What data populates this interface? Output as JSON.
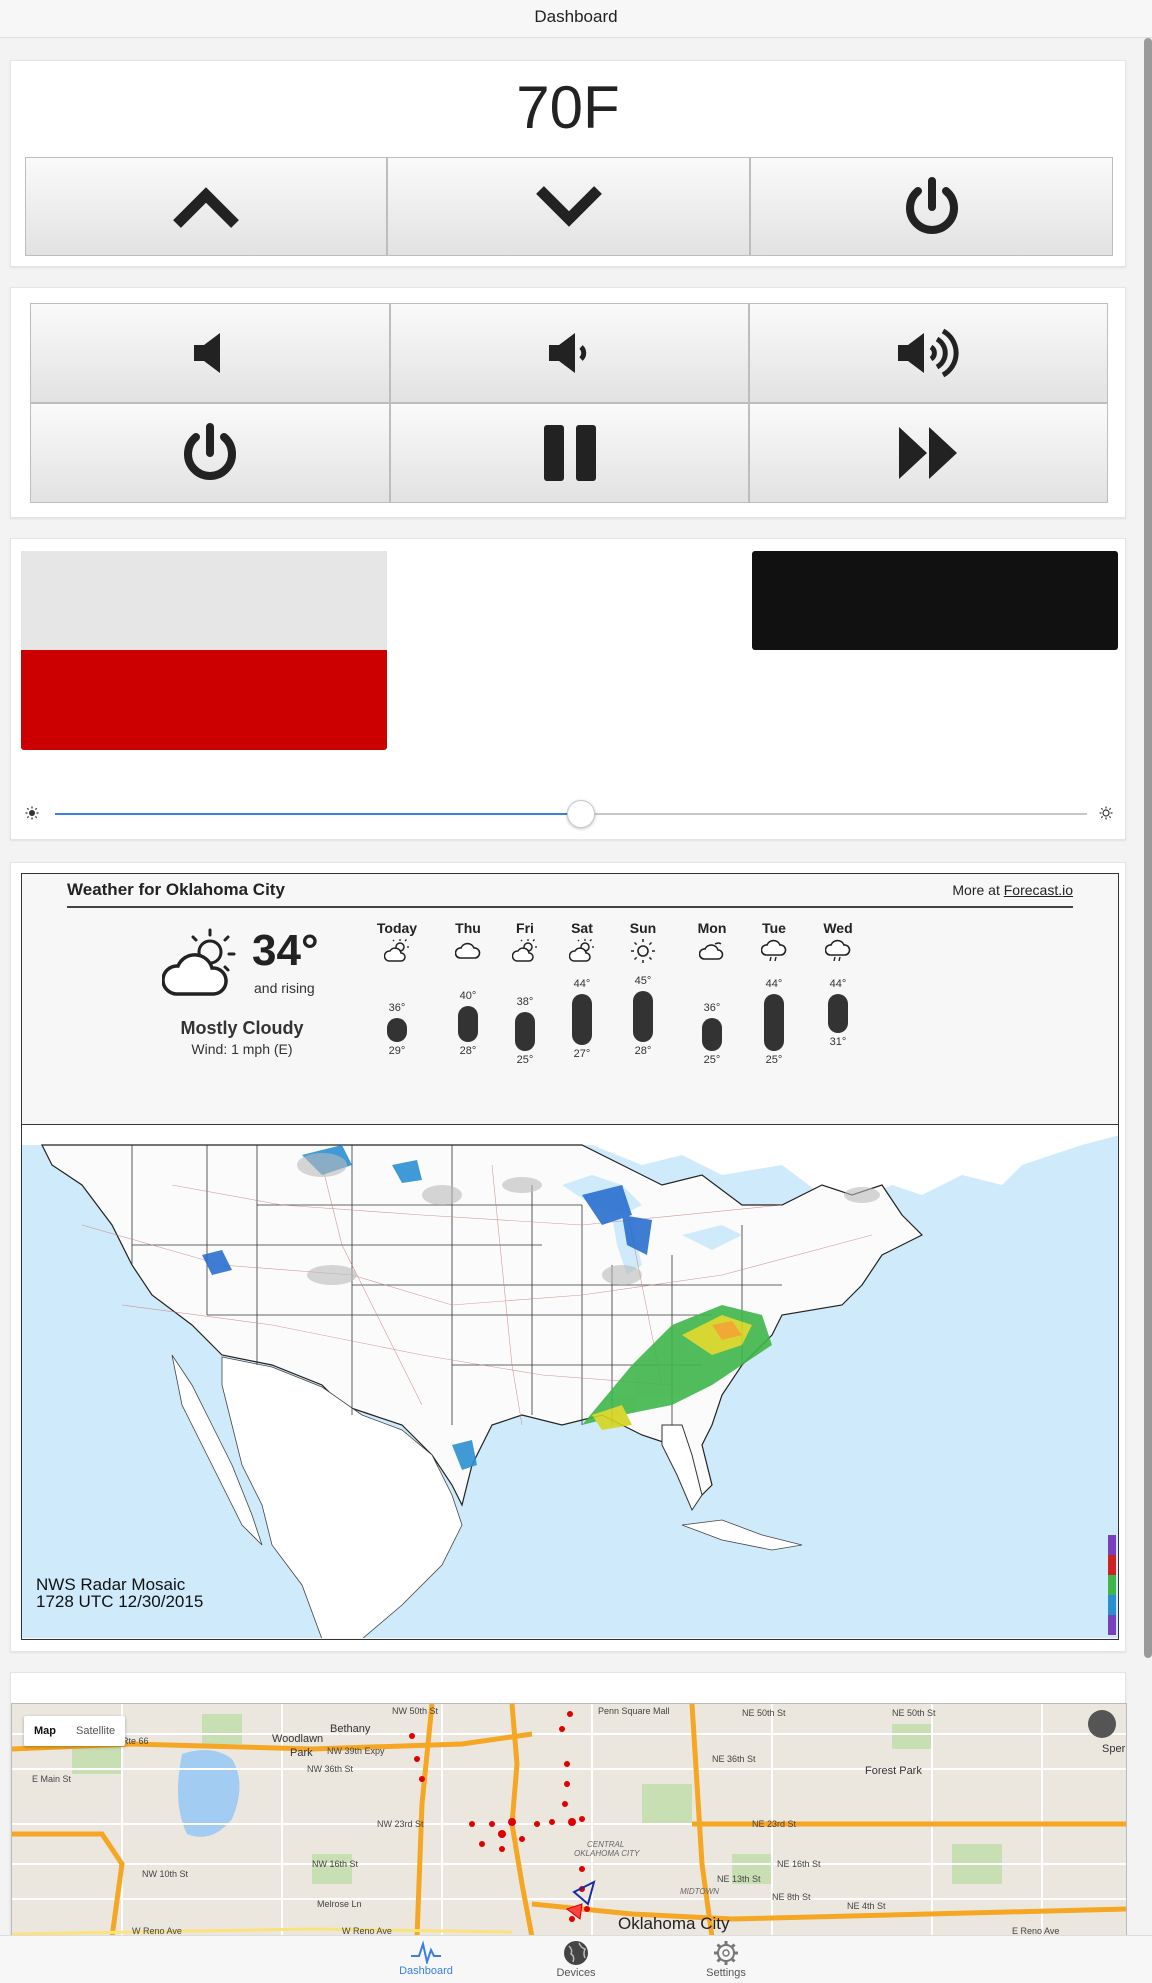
{
  "topbar": {
    "title": "Dashboard"
  },
  "thermostat": {
    "temperature": "70F"
  },
  "radar": {
    "label_line1": "NWS Radar Mosaic",
    "label_line2": "1728 UTC 12/30/2015"
  },
  "weather": {
    "title": "Weather for Oklahoma City",
    "more_prefix": "More at",
    "more_link": "Forecast.io",
    "current": {
      "temp": "34°",
      "trend": "and rising",
      "summary": "Mostly Cloudy",
      "wind": "Wind: 1 mph (E)"
    },
    "days": [
      {
        "name": "Today",
        "icon": "partly-cloudy-icon",
        "hi": "36°",
        "lo": "29°",
        "hi_n": 36,
        "lo_n": 29
      },
      {
        "name": "Thu",
        "icon": "cloudy-icon",
        "hi": "40°",
        "lo": "28°",
        "hi_n": 40,
        "lo_n": 28
      },
      {
        "name": "Fri",
        "icon": "partly-cloudy-icon",
        "hi": "38°",
        "lo": "25°",
        "hi_n": 38,
        "lo_n": 25
      },
      {
        "name": "Sat",
        "icon": "partly-cloudy-icon",
        "hi": "44°",
        "lo": "27°",
        "hi_n": 44,
        "lo_n": 27
      },
      {
        "name": "Sun",
        "icon": "sunny-icon",
        "hi": "45°",
        "lo": "28°",
        "hi_n": 45,
        "lo_n": 28
      },
      {
        "name": "Mon",
        "icon": "wind-cloud-icon",
        "hi": "36°",
        "lo": "25°",
        "hi_n": 36,
        "lo_n": 25
      },
      {
        "name": "Tue",
        "icon": "rain-cloud-icon",
        "hi": "44°",
        "lo": "25°",
        "hi_n": 44,
        "lo_n": 25
      },
      {
        "name": "Wed",
        "icon": "rain-cloud-icon",
        "hi": "44°",
        "lo": "31°",
        "hi_n": 44,
        "lo_n": 31
      }
    ]
  },
  "light_controls": {
    "swatches": [
      {
        "name": "light-gray-swatch",
        "color": "#e6e6e6"
      },
      {
        "name": "red-swatch",
        "color": "#cc0000"
      },
      {
        "name": "black-swatch",
        "color": "#111111"
      }
    ],
    "brightness_level": 0.51
  },
  "map": {
    "type_map": "Map",
    "type_satellite": "Satellite",
    "city_label": "Oklahoma City",
    "labels": {
      "bethany": "Bethany",
      "woodlawn": "Woodlawn\nPark",
      "forest_park": "Forest Park",
      "penn_square": "Penn Square Mall",
      "central": "CENTRAL\nOKLAHOMA CITY",
      "midtown": "MIDTOWN",
      "nw39": "NW 39th Expy",
      "rte66": "Rte 66",
      "nw50": "NW 50th St",
      "ne50": "NE 50th St",
      "ne36": "NE 36th St",
      "ne23": "NE 23rd St",
      "nw23": "NW 23rd St",
      "nw36": "NW 36th St",
      "nw16": "NW 16th St",
      "nw10": "NW 10th St",
      "ne16": "NE 16th St",
      "ne13": "NE 13th St",
      "ne8": "NE 8th St",
      "ne4": "NE 4th St",
      "melrose": "Melrose Ln",
      "wreno": "W Reno Ave",
      "ereno": "E Reno Ave",
      "emain": "E Main St",
      "spen": "Sper"
    }
  },
  "bottom_tabs": [
    {
      "label": "Dashboard",
      "active": true
    },
    {
      "label": "Devices",
      "active": false
    },
    {
      "label": "Settings",
      "active": false
    }
  ],
  "colors": {
    "accent": "#3b7fe0",
    "button_icon": "#222222"
  }
}
